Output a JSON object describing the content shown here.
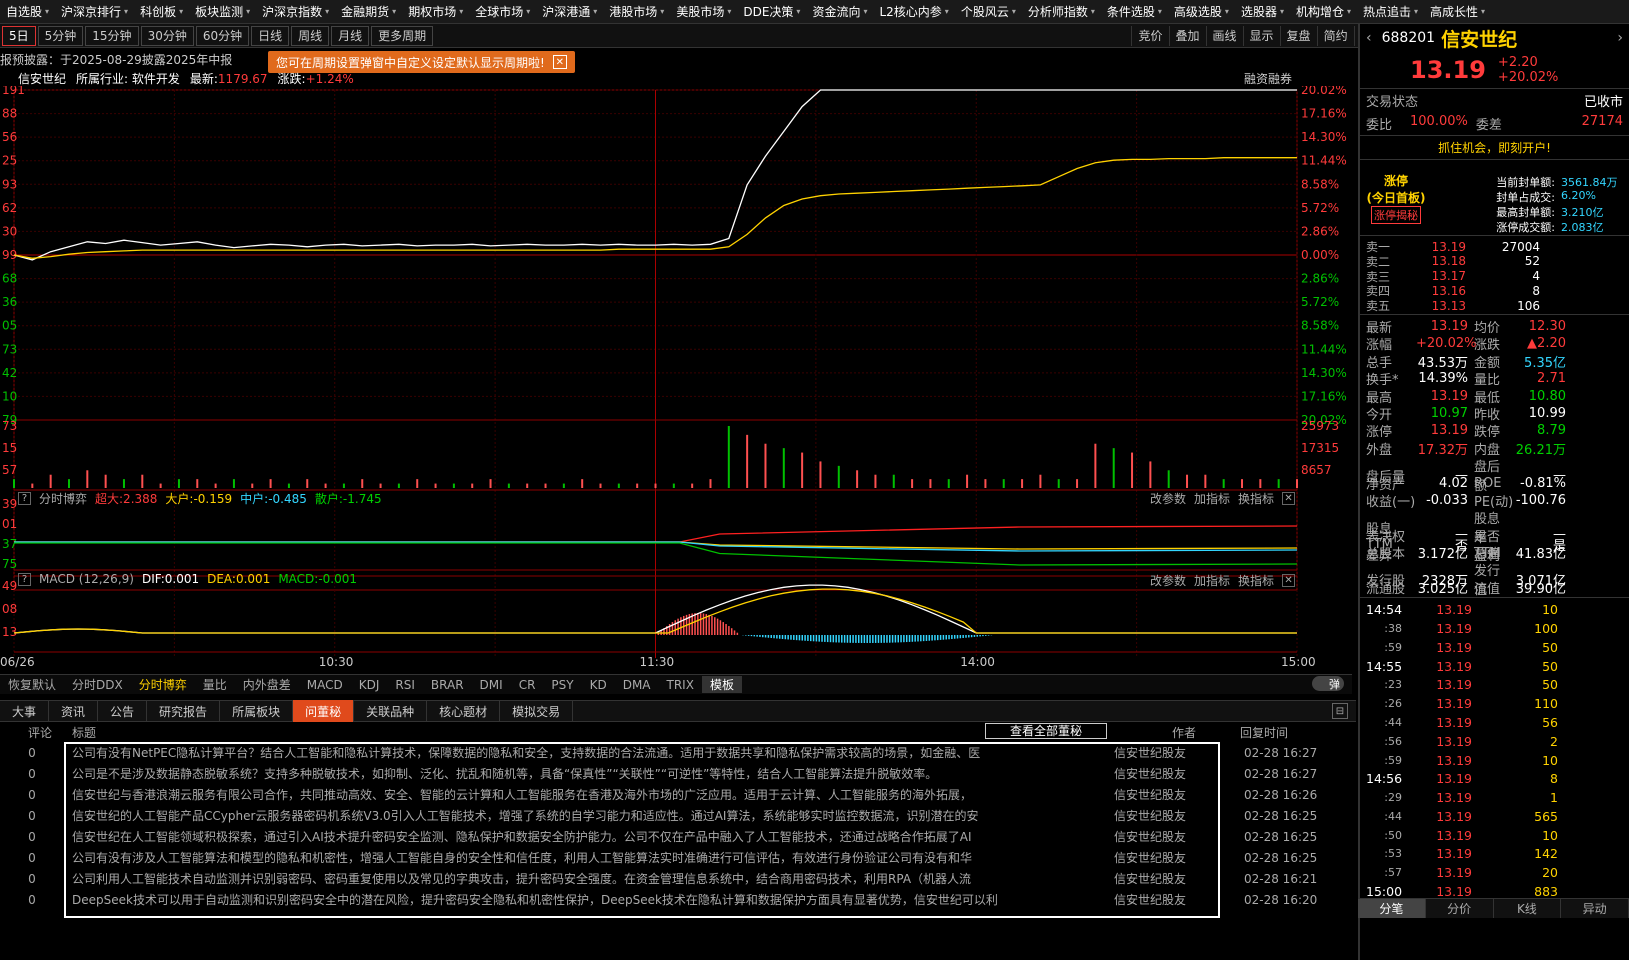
{
  "top_menu": [
    "自选股",
    "沪深京排行",
    "科创板",
    "板块监测",
    "沪深京指数",
    "金融期货",
    "期权市场",
    "全球市场",
    "沪深港通",
    "港股市场",
    "美股市场",
    "DDE决策",
    "资金流向",
    "L2核心内参",
    "个股风云",
    "分析师指数",
    "条件选股",
    "高级选股",
    "选股器",
    "机构增仓",
    "热点追击",
    "高成长性"
  ],
  "periods": [
    "5日",
    "5分钟",
    "15分钟",
    "30分钟",
    "60分钟",
    "日线",
    "周线",
    "月线",
    "更多周期"
  ],
  "active_period": "5日",
  "right_tools": [
    "竞价",
    "叠加",
    "画线",
    "显示",
    "复盘",
    "简约",
    "隐藏"
  ],
  "banner_text": "报预披露：于2025-08-29披露2025年中报",
  "tooltip_text": "您可在周期设置弹窗中自定义设定默认显示周期啦!",
  "stock_line": {
    "name": "信安世纪",
    "industry": "所属行业: 软件开发",
    "latest_label": "最新:",
    "latest": "1179.67",
    "change_label": "涨跌:",
    "change": "+1.24%"
  },
  "margin_label": "融资融券",
  "chart_data": {
    "type": "line",
    "left_axis": [
      "191",
      "88",
      "56",
      "25",
      "93",
      "62",
      "30",
      "99",
      "68",
      "36",
      "05",
      "73",
      "42",
      "10",
      "79"
    ],
    "right_axis_pct": [
      "20.02%",
      "17.16%",
      "14.30%",
      "11.44%",
      "8.58%",
      "5.72%",
      "2.86%",
      "0.00%",
      "2.86%",
      "5.72%",
      "8.58%",
      "11.44%",
      "14.30%",
      "17.16%",
      "20.02%"
    ],
    "vol_axis_left": [
      "73",
      "15",
      "57"
    ],
    "vol_axis_right": [
      "25973",
      "17315",
      "8657"
    ],
    "ind1_axis": [
      "39",
      "01",
      "37",
      "75"
    ],
    "ind2_axis": [
      "49",
      "08",
      "13"
    ],
    "x_labels": [
      "06/26",
      "10:30",
      "11:30",
      "14:00",
      "15:00"
    ],
    "series": [
      {
        "color": "#ffffff",
        "values": [
          0.0,
          -0.6,
          0.4,
          1.0,
          1.6,
          1.4,
          1.8,
          1.5,
          1.2,
          1.4,
          1.6,
          1.2,
          0.9,
          1.1,
          1.3,
          1.2,
          1.0,
          1.2,
          1.3,
          1.1,
          1.2,
          1.3,
          1.1,
          1.2,
          1.2,
          1.3,
          1.1,
          1.2,
          1.3,
          1.2,
          1.2,
          1.3,
          1.2,
          1.3,
          1.2,
          1.2,
          1.3,
          1.2,
          1.3,
          2.0,
          8.5,
          12.0,
          15.0,
          18.0,
          20.02,
          20.02,
          20.02,
          20.02,
          20.02,
          20.02,
          20.02,
          20.02,
          20.02,
          20.02,
          20.02,
          20.02,
          20.02,
          20.02,
          20.02,
          20.02,
          20.02,
          20.02,
          20.02,
          20.02,
          20.02,
          20.02,
          20.02,
          20.02,
          20.02,
          20.02,
          20.02
        ]
      },
      {
        "color": "#ffd200",
        "values": [
          0.0,
          -0.4,
          -0.2,
          0.1,
          0.3,
          0.4,
          0.5,
          0.6,
          0.6,
          0.6,
          0.6,
          0.6,
          0.6,
          0.6,
          0.6,
          0.6,
          0.6,
          0.6,
          0.6,
          0.6,
          0.6,
          0.6,
          0.6,
          0.6,
          0.6,
          0.6,
          0.6,
          0.6,
          0.6,
          0.6,
          0.6,
          0.6,
          0.6,
          0.7,
          0.7,
          0.7,
          0.7,
          0.7,
          0.7,
          1.0,
          2.5,
          4.5,
          6.0,
          6.8,
          7.2,
          7.4,
          7.5,
          7.6,
          7.7,
          7.8,
          7.9,
          8.0,
          8.1,
          8.2,
          8.3,
          8.4,
          8.5,
          9.5,
          10.5,
          11.2,
          11.5,
          11.6,
          11.6,
          11.7,
          11.7,
          11.7,
          11.8,
          11.8,
          11.8,
          11.8,
          11.8
        ]
      }
    ],
    "volume": [
      2,
      1,
      3,
      2,
      4,
      3,
      2,
      3,
      1,
      2,
      2,
      1,
      2,
      1,
      2,
      1,
      2,
      1,
      1,
      2,
      1,
      1,
      2,
      1,
      1,
      1,
      2,
      1,
      1,
      1,
      1,
      2,
      1,
      1,
      1,
      1,
      1,
      1,
      2,
      14,
      12,
      10,
      9,
      8,
      6,
      5,
      4,
      3,
      3,
      2,
      2,
      2,
      3,
      2,
      2,
      2,
      3,
      2,
      2,
      10,
      9,
      8,
      6,
      4,
      3,
      3,
      2,
      2,
      2,
      2,
      2
    ]
  },
  "ind1": {
    "label": "分时博弈",
    "a": "超大:2.388",
    "b": "大户:-0.159",
    "c": "中户:-0.485",
    "d": "散户:-1.745"
  },
  "ind2": {
    "label": "MACD (12,26,9)",
    "dif": "DIF:0.001",
    "dea": "DEA:0.001",
    "macd": "MACD:-0.001"
  },
  "ind_tools": [
    "改参数",
    "加指标",
    "换指标"
  ],
  "indicator_tabs": [
    "恢复默认",
    "分时DDX",
    "分时博弈",
    "量比",
    "内外盘差",
    "MACD",
    "KDJ",
    "RSI",
    "BRAR",
    "DMI",
    "CR",
    "PSY",
    "KD",
    "DMA",
    "TRIX",
    "模板"
  ],
  "active_indicator": "分时博弈",
  "news_tabs": [
    "大事",
    "资讯",
    "公告",
    "研究报告",
    "所属板块",
    "问董秘",
    "关联品种",
    "核心题材",
    "模拟交易"
  ],
  "active_news_tab": "问董秘",
  "news_header": {
    "count": "评论",
    "title": "标题",
    "view_all": "查看全部董秘",
    "author": "作者",
    "time": "回复时间"
  },
  "news_rows": [
    {
      "count": "0",
      "title": "公司有没有NetPEC隐私计算平台？结合人工智能和隐私计算技术，保障数据的隐私和安全，支持数据的合法流通。适用于数据共享和隐私保护需求较高的场景，如金融、医",
      "author": "信安世纪股友",
      "time": "02-28 16:27"
    },
    {
      "count": "0",
      "title": "公司是不是涉及数据静态脱敏系统？支持多种脱敏技术，如抑制、泛化、扰乱和随机等，具备“保真性”“关联性”“可逆性”等特性，结合人工智能算法提升脱敏效率。",
      "author": "信安世纪股友",
      "time": "02-28 16:27"
    },
    {
      "count": "0",
      "title": "信安世纪与香港浪潮云服务有限公司合作，共同推动高效、安全、智能的云计算和人工智能服务在香港及海外市场的广泛应用。适用于云计算、人工智能服务的海外拓展，",
      "author": "信安世纪股友",
      "time": "02-28 16:26"
    },
    {
      "count": "0",
      "title": "信安世纪的人工智能产品CCypher云服务器密码机系统V3.0引入人工智能技术，增强了系统的自学习能力和适应性。通过AI算法，系统能够实时监控数据流，识别潜在的安",
      "author": "信安世纪股友",
      "time": "02-28 16:25"
    },
    {
      "count": "0",
      "title": "信安世纪在人工智能领域积极探索，通过引入AI技术提升密码安全监测、隐私保护和数据安全防护能力。公司不仅在产品中融入了人工智能技术，还通过战略合作拓展了AI",
      "author": "信安世纪股友",
      "time": "02-28 16:25"
    },
    {
      "count": "0",
      "title": "公司有没有涉及人工智能算法和模型的隐私和机密性，增强人工智能自身的安全性和信任度，利用人工智能算法实时准确进行可信评估，有效进行身份验证公司有没有和华",
      "author": "信安世纪股友",
      "time": "02-28 16:25"
    },
    {
      "count": "0",
      "title": "公司利用人工智能技术自动监测并识别弱密码、密码重复使用以及常见的字典攻击，提升密码安全强度。在资金管理信息系统中，结合商用密码技术，利用RPA（机器人流",
      "author": "信安世纪股友",
      "time": "02-28 16:21"
    },
    {
      "count": "0",
      "title": "DeepSeek技术可以用于自动监测和识别密码安全中的潜在风险，提升密码安全隐私和机密性保护，DeepSeek技术在隐私计算和数据保护方面具有显著优势，信安世纪可以利",
      "author": "信安世纪股友",
      "time": "02-28 16:20"
    }
  ],
  "right_panel": {
    "code": "688201",
    "name": "信安世纪",
    "price": "13.19",
    "change": "+2.20",
    "change_pct": "+20.02%",
    "status_label": "交易状态",
    "status_value": "已收市",
    "weibi_label": "委比",
    "weibi_value": "100.00%",
    "weicha_label": "委差",
    "weicha_value": "27174",
    "promo": "抓住机会，即刻开户!",
    "limit_title": "涨停",
    "limit_sub": "(今日首板)",
    "limit_btn": "涨停揭秘",
    "limit_stats": [
      {
        "k": "当前封单额:",
        "v": "3561.84万"
      },
      {
        "k": "封单占成交:",
        "v": "6.20%"
      },
      {
        "k": "最高封单额:",
        "v": "3.210亿"
      },
      {
        "k": "涨停成交额:",
        "v": "2.083亿"
      }
    ],
    "orderbook": [
      {
        "l": "卖一",
        "p": "13.19",
        "q": "27004"
      },
      {
        "l": "卖二",
        "p": "13.18",
        "q": "52"
      },
      {
        "l": "卖三",
        "p": "13.17",
        "q": "4"
      },
      {
        "l": "卖四",
        "p": "13.16",
        "q": "8"
      },
      {
        "l": "卖五",
        "p": "13.13",
        "q": "106"
      }
    ],
    "stats": [
      {
        "k": "最新",
        "v": "13.19",
        "vc": "red",
        "k2": "均价",
        "v2": "12.30",
        "v2c": "red"
      },
      {
        "k": "涨幅",
        "v": "+20.02%",
        "vc": "red",
        "k2": "涨跌",
        "v2": "▲2.20",
        "v2c": "red"
      },
      {
        "k": "总手",
        "v": "43.53万",
        "vc": "white",
        "k2": "金额",
        "v2": "5.35亿",
        "v2c": "cyan"
      },
      {
        "k": "换手*",
        "v": "14.39%",
        "vc": "white",
        "k2": "量比",
        "v2": "2.71",
        "v2c": "red"
      },
      {
        "k": "最高",
        "v": "13.19",
        "vc": "red",
        "k2": "最低",
        "v2": "10.80",
        "v2c": "green"
      },
      {
        "k": "今开",
        "v": "10.97",
        "vc": "green",
        "k2": "昨收",
        "v2": "10.99",
        "v2c": "white"
      },
      {
        "k": "涨停",
        "v": "13.19",
        "vc": "red",
        "k2": "跌停",
        "v2": "8.79",
        "v2c": "green"
      },
      {
        "k": "外盘",
        "v": "17.32万",
        "vc": "red",
        "k2": "内盘",
        "v2": "26.21万",
        "v2c": "green"
      },
      {
        "k": "盘后量",
        "v": "—",
        "vc": "white",
        "k2": "盘后额",
        "v2": "—",
        "v2c": "white"
      },
      {
        "k": "净资产",
        "v": "4.02",
        "vc": "white",
        "k2": "ROE",
        "v2": "-0.81%",
        "v2c": "white"
      },
      {
        "k": "收益(一)",
        "v": "-0.033",
        "vc": "white",
        "k2": "PE(动)",
        "v2": "-100.76",
        "v2c": "white"
      },
      {
        "k": "股息TTM",
        "v": "—",
        "vc": "white",
        "k2": "股息率TTM",
        "v2": "—",
        "v2c": "white"
      },
      {
        "k": "表决权差异",
        "v": "否",
        "vc": "white",
        "k2": "是否盈利",
        "v2": "是",
        "v2c": "white"
      },
      {
        "k": "总股本",
        "v": "3.172亿",
        "vc": "white",
        "k2": "总值",
        "v2": "41.83亿",
        "v2c": "white"
      },
      {
        "k": "发行股",
        "v": "2328万",
        "vc": "white",
        "k2": "发行值",
        "v2": "3.071亿",
        "v2c": "white"
      },
      {
        "k": "流通股",
        "v": "3.025亿",
        "vc": "white",
        "k2": "流值",
        "v2": "39.90亿",
        "v2c": "white"
      }
    ],
    "ticks": [
      {
        "t": "14:54",
        "p": "13.19",
        "v": "10",
        "sub": false
      },
      {
        "t": ":38",
        "p": "13.19",
        "v": "100",
        "sub": true
      },
      {
        "t": ":59",
        "p": "13.19",
        "v": "50",
        "sub": true
      },
      {
        "t": "14:55",
        "p": "13.19",
        "v": "50",
        "sub": false
      },
      {
        "t": ":23",
        "p": "13.19",
        "v": "50",
        "sub": true
      },
      {
        "t": ":26",
        "p": "13.19",
        "v": "110",
        "sub": true
      },
      {
        "t": ":44",
        "p": "13.19",
        "v": "56",
        "sub": true
      },
      {
        "t": ":56",
        "p": "13.19",
        "v": "2",
        "sub": true
      },
      {
        "t": ":59",
        "p": "13.19",
        "v": "10",
        "sub": true
      },
      {
        "t": "14:56",
        "p": "13.19",
        "v": "8",
        "sub": false
      },
      {
        "t": ":29",
        "p": "13.19",
        "v": "1",
        "sub": true
      },
      {
        "t": ":44",
        "p": "13.19",
        "v": "565",
        "sub": true
      },
      {
        "t": ":50",
        "p": "13.19",
        "v": "10",
        "sub": true
      },
      {
        "t": ":53",
        "p": "13.19",
        "v": "142",
        "sub": true
      },
      {
        "t": ":57",
        "p": "13.19",
        "v": "20",
        "sub": true
      },
      {
        "t": "15:00",
        "p": "13.19",
        "v": "883",
        "sub": false
      }
    ],
    "bottom_tabs": [
      "分笔",
      "分价",
      "K线",
      "异动"
    ]
  }
}
